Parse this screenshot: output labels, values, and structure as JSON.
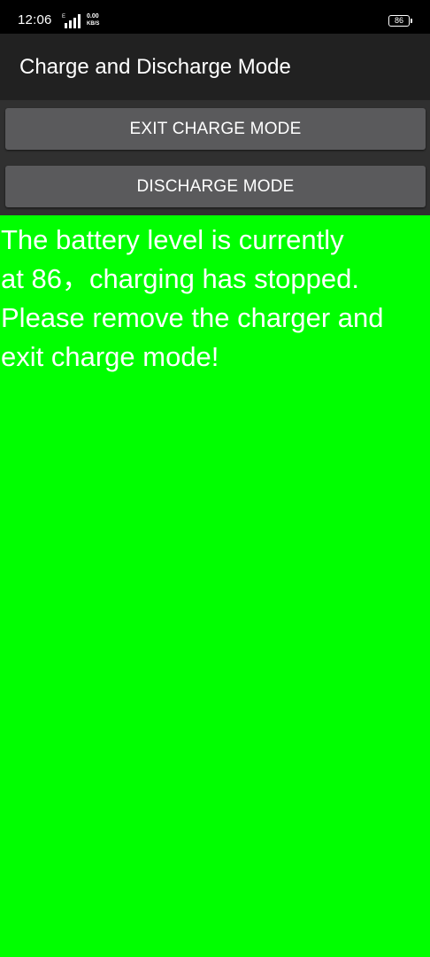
{
  "status_bar": {
    "time": "12:06",
    "network_type": "E",
    "speed_value": "0.00",
    "speed_unit": "KB/S",
    "battery_level": "86",
    "icons": [
      "signal-icon",
      "battery-icon"
    ]
  },
  "app_bar": {
    "title": "Charge and Discharge Mode",
    "background_color": "#212121"
  },
  "buttons": {
    "exit_charge_mode": "EXIT CHARGE MODE",
    "discharge_mode": "DISCHARGE MODE",
    "button_color": "#5a5a5c"
  },
  "message": {
    "line1": "The battery level is currently",
    "line2": "at 86，charging has stopped.",
    "line3": "Please remove the charger and",
    "line4": "exit charge mode!",
    "background_color": "#00ff00",
    "text_color": "#ffffff"
  }
}
